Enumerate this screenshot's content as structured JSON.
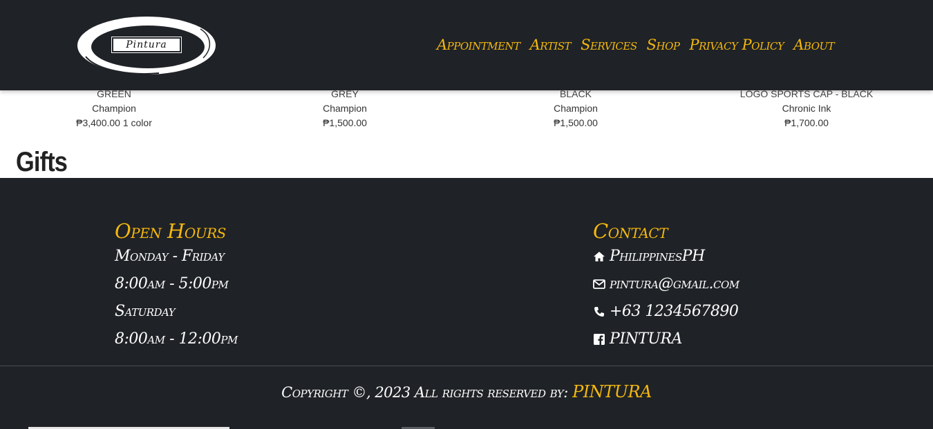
{
  "header": {
    "logo_text": "Pintura",
    "nav": [
      "Appointment",
      "Artist",
      "Services",
      "Shop",
      "Privacy Policy",
      "About"
    ]
  },
  "products": [
    {
      "name": "GREEN",
      "brand": "Champion",
      "price": "₱3,400.00 1 color"
    },
    {
      "name": "GREY",
      "brand": "Champion",
      "price": "₱1,500.00"
    },
    {
      "name": "BLACK",
      "brand": "Champion",
      "price": "₱1,500.00"
    },
    {
      "name": "LOGO SPORTS CAP - BLACK",
      "brand": "Chronic Ink",
      "price": "₱1,700.00"
    }
  ],
  "section_heading": "Gifts",
  "footer": {
    "hours": {
      "title": "Open Hours",
      "lines": [
        "Monday - Friday",
        "8:00am - 5:00pm",
        "Saturday",
        "8:00am - 12:00pm"
      ]
    },
    "contact": {
      "title": "Contact",
      "address": "PhilippinesPH",
      "email": "pintura@gmail.com",
      "phone": "+63 1234567890",
      "facebook": "PINTURA",
      "icons": [
        "home-icon",
        "envelope-icon",
        "phone-icon",
        "facebook-icon"
      ]
    },
    "copyright_prefix": "Copyright ©, 2023 All rights reserved by:",
    "copyright_brand": "PINTURA"
  },
  "colors": {
    "accent": "#f5b80f",
    "dark": "#1f2226"
  }
}
